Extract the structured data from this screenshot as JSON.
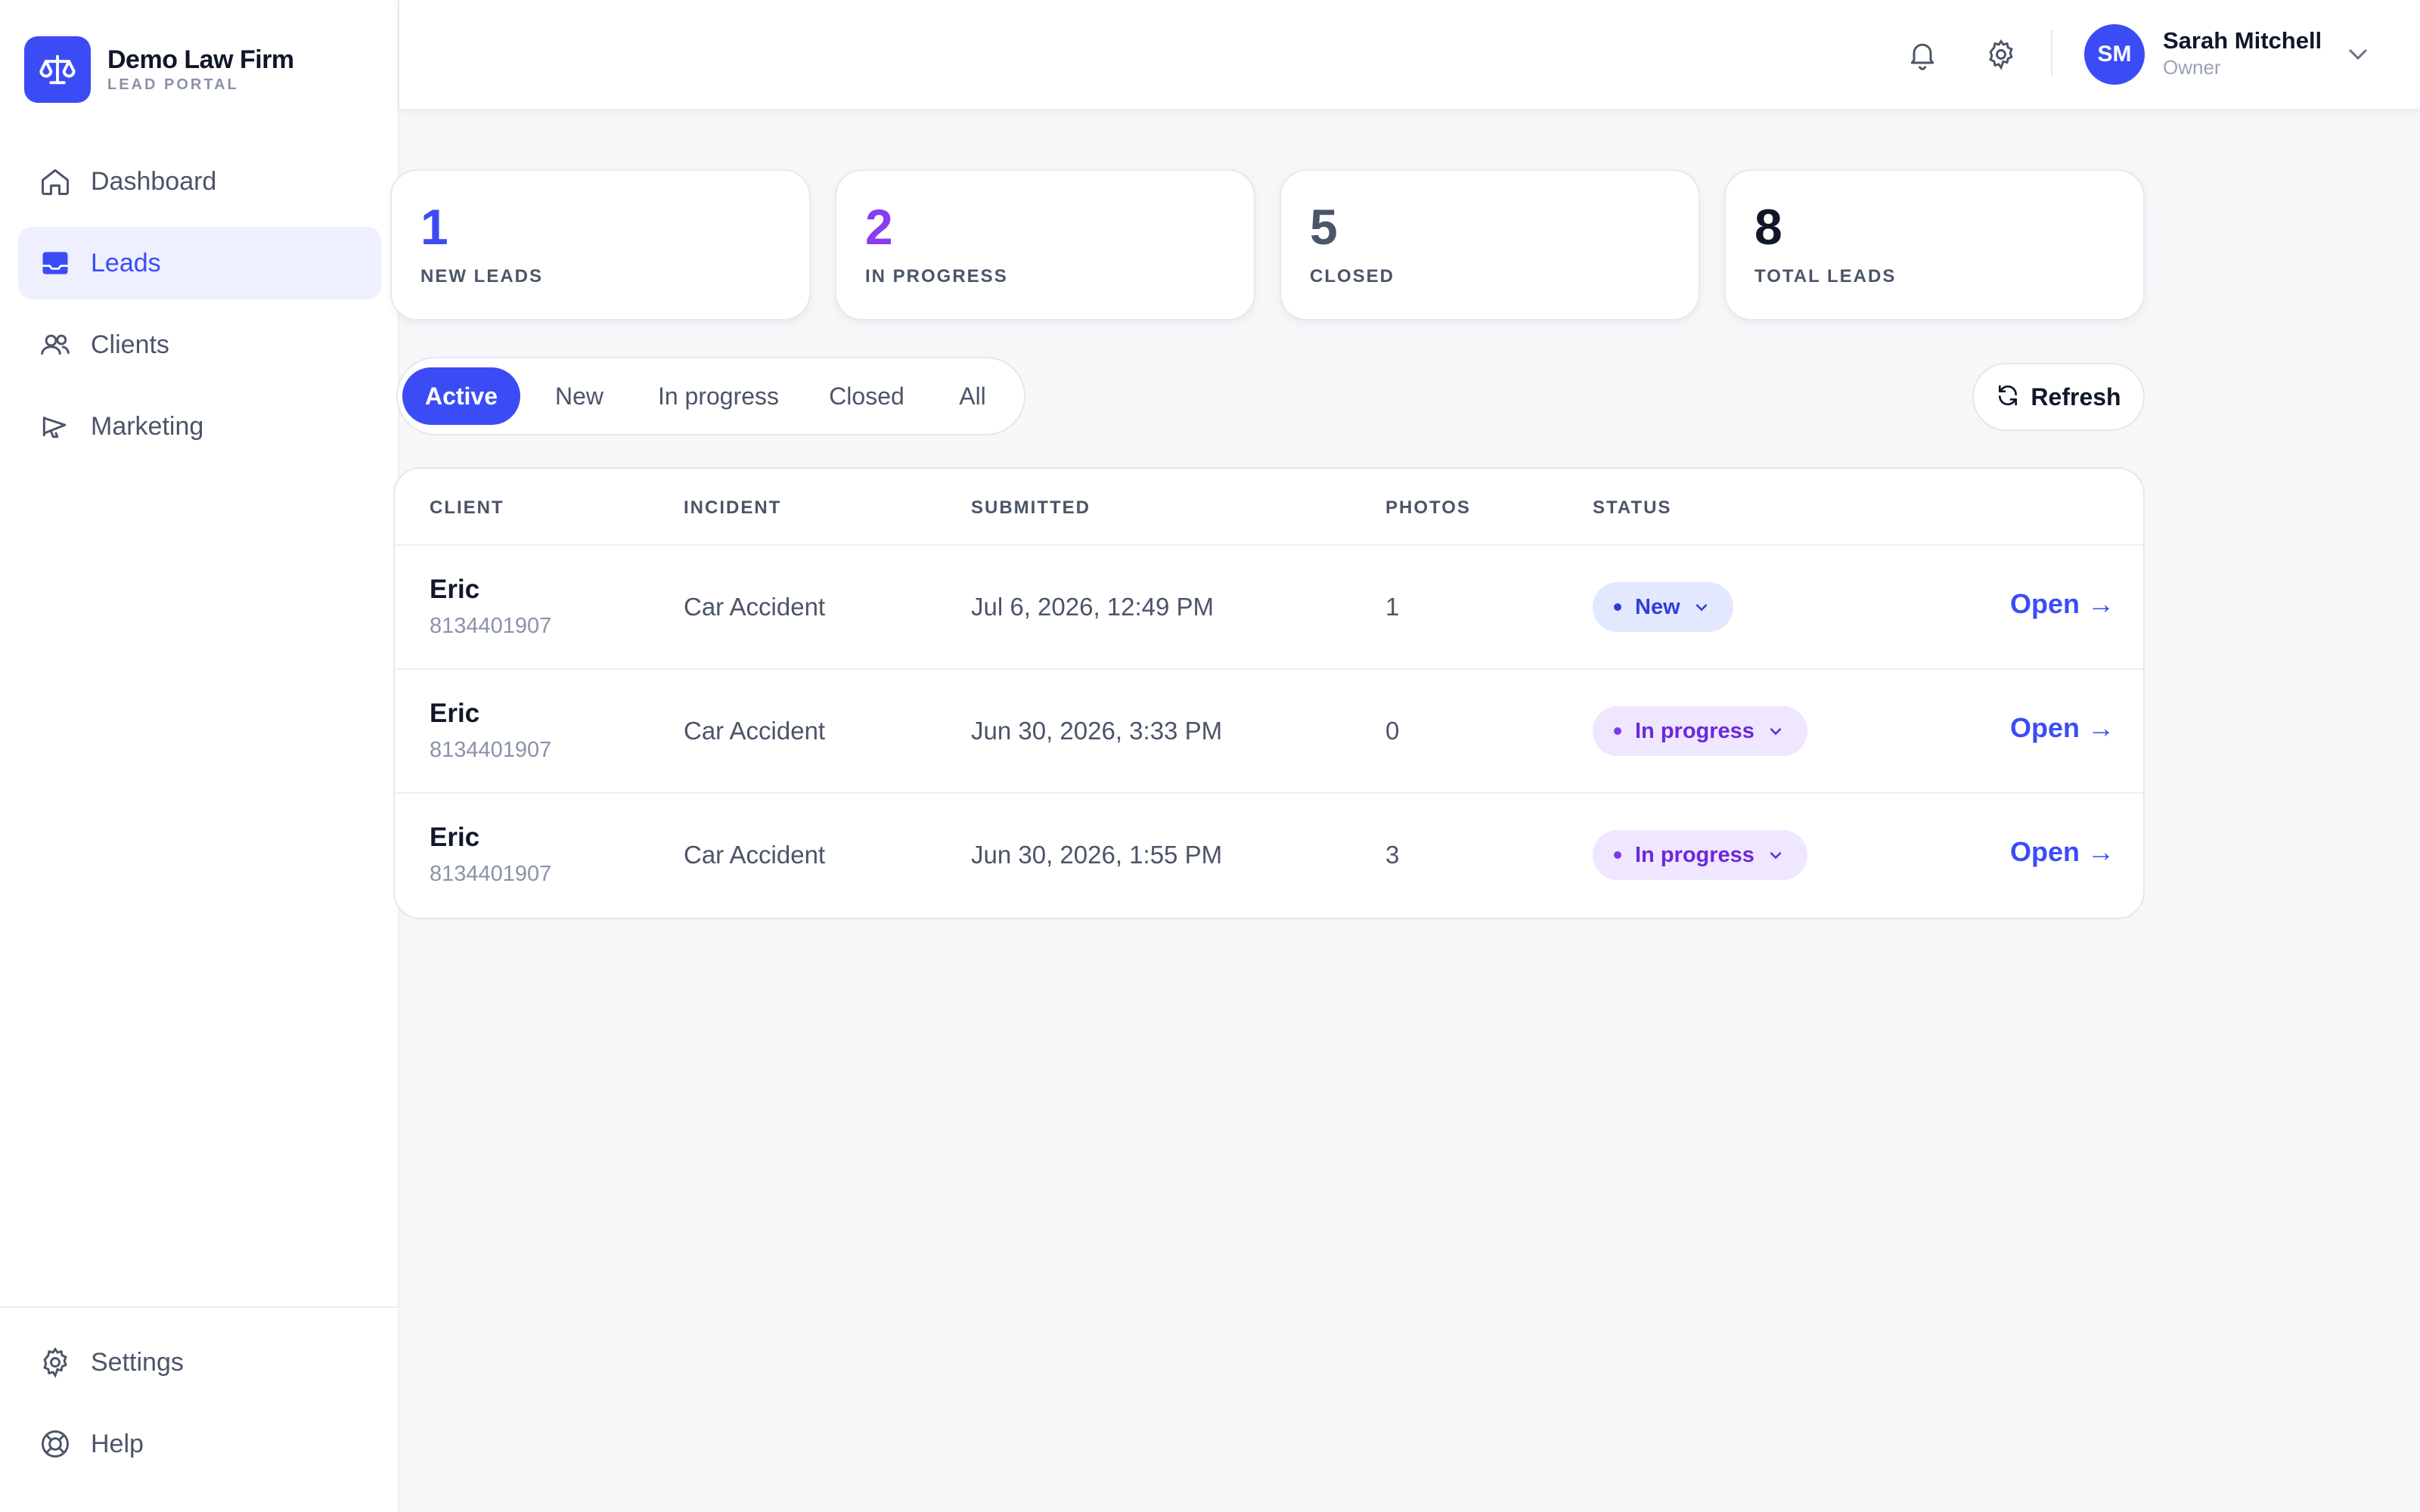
{
  "brand": {
    "name": "Demo Law Firm",
    "subtitle": "LEAD PORTAL"
  },
  "sidebar": {
    "items": [
      {
        "label": "Dashboard",
        "icon": "home-icon",
        "active": false
      },
      {
        "label": "Leads",
        "icon": "inbox-icon",
        "active": true
      },
      {
        "label": "Clients",
        "icon": "users-icon",
        "active": false
      },
      {
        "label": "Marketing",
        "icon": "megaphone-icon",
        "active": false
      }
    ],
    "bottom": [
      {
        "label": "Settings",
        "icon": "gear-icon"
      },
      {
        "label": "Help",
        "icon": "lifebuoy-icon"
      }
    ]
  },
  "header": {
    "user": {
      "initials": "SM",
      "name": "Sarah Mitchell",
      "role": "Owner"
    }
  },
  "stats": [
    {
      "value": "1",
      "label": "NEW LEADS",
      "color": "#3b4cf6"
    },
    {
      "value": "2",
      "label": "IN PROGRESS",
      "color": "#8b3cf0"
    },
    {
      "value": "5",
      "label": "CLOSED",
      "color": "#4b5568"
    },
    {
      "value": "8",
      "label": "TOTAL LEADS",
      "color": "#0f1729"
    }
  ],
  "filters": {
    "tabs": [
      "Active",
      "New",
      "In progress",
      "Closed",
      "All"
    ],
    "active": "Active"
  },
  "refresh_label": "Refresh",
  "table": {
    "columns": [
      "CLIENT",
      "INCIDENT",
      "SUBMITTED",
      "PHOTOS",
      "STATUS"
    ],
    "rows": [
      {
        "name": "Eric",
        "phone": "8134401907",
        "incident": "Car Accident",
        "submitted": "Jul 6, 2026, 12:49 PM",
        "photos": "1",
        "status": "New",
        "action": "Open →"
      },
      {
        "name": "Eric",
        "phone": "8134401907",
        "incident": "Car Accident",
        "submitted": "Jun 30, 2026, 3:33 PM",
        "photos": "0",
        "status": "In progress",
        "action": "Open →"
      },
      {
        "name": "Eric",
        "phone": "8134401907",
        "incident": "Car Accident",
        "submitted": "Jun 30, 2026, 1:55 PM",
        "photos": "3",
        "status": "In progress",
        "action": "Open →"
      }
    ]
  },
  "colors": {
    "accent": "#3b4cf6",
    "status_new_bg": "#e3e8ff",
    "status_new_fg": "#2f3fd8",
    "status_progress_bg": "#efe6ff",
    "status_progress_fg": "#6d28d9"
  }
}
